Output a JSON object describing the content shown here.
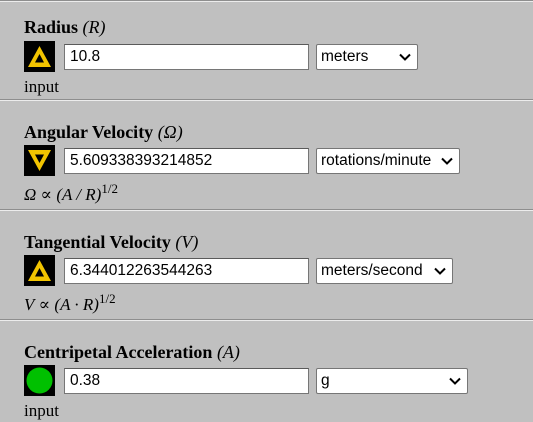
{
  "colors": {
    "background": "#c0c0c0",
    "button_bg": "#000000",
    "arrow_fill": "#f2c400",
    "input_indicator": "#00c000"
  },
  "sections": [
    {
      "label": "Radius",
      "symbol": "(R)",
      "button_icon": "arrow-up-icon",
      "value": "10.8",
      "unit": "meters",
      "note": "input"
    },
    {
      "label": "Angular Velocity",
      "symbol": "(Ω)",
      "button_icon": "arrow-down-icon",
      "value": "5.609338393214852",
      "unit": "rotations/minute",
      "note_lhs": "Ω",
      "note_prop": " ∝ ",
      "note_expr": "(A / R)",
      "note_exp": "1/2"
    },
    {
      "label": "Tangential Velocity",
      "symbol": "(V)",
      "button_icon": "arrow-up-icon",
      "value": "6.344012263544263",
      "unit": "meters/second",
      "note_lhs": "V",
      "note_prop": " ∝ ",
      "note_expr": "(A · R)",
      "note_exp": "1/2"
    },
    {
      "label": "Centripetal Acceleration",
      "symbol": "(A)",
      "button_icon": "green-dot-icon",
      "value": "0.38",
      "unit": "g",
      "note": "input"
    }
  ]
}
